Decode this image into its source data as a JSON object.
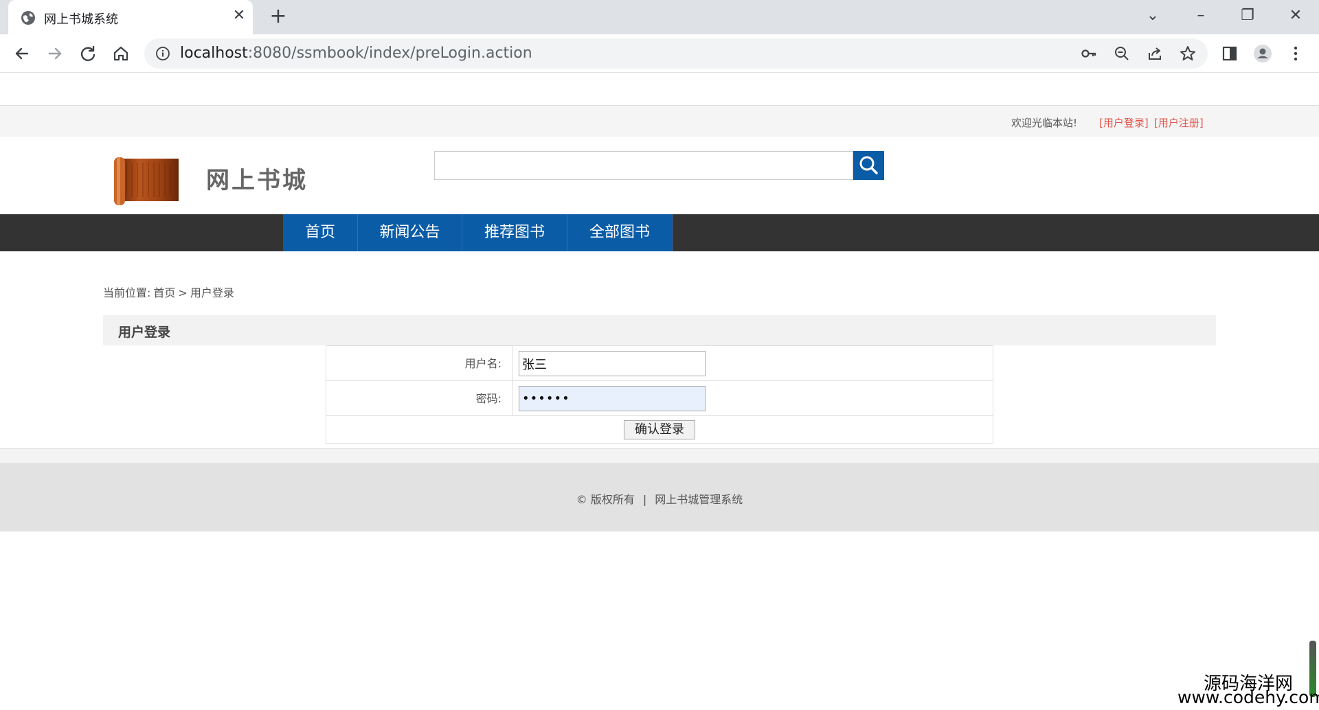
{
  "browser": {
    "tab_title": "网上书城系统",
    "new_tab": "+",
    "url_host": "localhost",
    "url_rest": ":8080/ssmbook/index/preLogin.action"
  },
  "site": {
    "welcome": "欢迎光临本站!",
    "login_link": "[用户登录]",
    "register_link": "[用户注册]",
    "logo_title": "网上书城",
    "search_value": ""
  },
  "nav": {
    "items": [
      {
        "label": "首页"
      },
      {
        "label": "新闻公告"
      },
      {
        "label": "推荐图书"
      },
      {
        "label": "全部图书"
      }
    ]
  },
  "breadcrumb": {
    "prefix": "当前位置:",
    "home": "首页",
    "sep": ">",
    "current": "用户登录"
  },
  "login": {
    "title": "用户登录",
    "username_label": "用户名:",
    "username_value": "张三",
    "password_label": "密码:",
    "password_value": "••••••",
    "submit": "确认登录"
  },
  "footer": {
    "copyright": "© 版权所有",
    "sep": "|",
    "system": "网上书城管理系统"
  },
  "watermark": {
    "line1": "源码海洋网",
    "line2": "www.codehy.com"
  },
  "colors": {
    "accent": "#0b5ca6",
    "navbar": "#333333",
    "link_red": "#e2544b"
  }
}
